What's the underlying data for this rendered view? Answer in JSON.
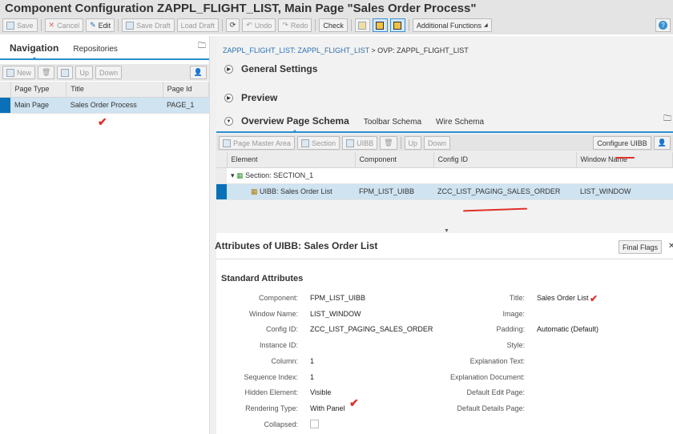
{
  "title": "Component Configuration ZAPPL_FLIGHT_LIST, Main Page \"Sales Order Process\"",
  "toolbar": {
    "save": "Save",
    "cancel": "Cancel",
    "edit": "Edit",
    "save_draft": "Save Draft",
    "load_draft": "Load Draft",
    "undo": "Undo",
    "redo": "Redo",
    "check": "Check",
    "additional": "Additional Functions"
  },
  "left": {
    "tabs": [
      "Navigation",
      "Repositories"
    ],
    "buttons": {
      "new": "New",
      "up": "Up",
      "down": "Down"
    },
    "columns": [
      "Page Type",
      "Title",
      "Page Id"
    ],
    "rows": [
      {
        "type": "Main Page",
        "title": "Sales Order Process",
        "id": "PAGE_1"
      }
    ]
  },
  "right": {
    "breadcrumb_link": "ZAPPL_FLIGHT_LIST: ZAPPL_FLIGHT_LIST",
    "breadcrumb_rest": "> OVP: ZAPPL_FLIGHT_LIST",
    "panels": [
      "General Settings",
      "Preview"
    ],
    "schema_tabs": [
      "Overview Page Schema",
      "Toolbar Schema",
      "Wire Schema"
    ],
    "schema_buttons": {
      "master": "Page Master Area",
      "section": "Section",
      "uibb": "UIBB",
      "up": "Up",
      "down": "Down",
      "configure": "Configure UIBB"
    },
    "columns": [
      "Element",
      "Component",
      "Config ID",
      "Window Name"
    ],
    "rows": [
      {
        "element": "Section: SECTION_1",
        "component": "",
        "config": "",
        "window": ""
      },
      {
        "element": "UIBB: Sales Order List",
        "component": "FPM_LIST_UIBB",
        "config": "ZCC_LIST_PAGING_SALES_ORDER",
        "window": "LIST_WINDOW"
      }
    ]
  },
  "attributes": {
    "title": "Attributes of UIBB: Sales Order List",
    "final_flags": "Final Flags",
    "section": "Standard Attributes",
    "left": [
      [
        "Component:",
        "FPM_LIST_UIBB"
      ],
      [
        "Window Name:",
        "LIST_WINDOW"
      ],
      [
        "Config ID:",
        "ZCC_LIST_PAGING_SALES_ORDER"
      ],
      [
        "Instance ID:",
        ""
      ],
      [
        "Column:",
        "1"
      ],
      [
        "Sequence Index:",
        "1"
      ],
      [
        "Hidden Element:",
        "Visible"
      ],
      [
        "Rendering Type:",
        "With Panel"
      ],
      [
        "Collapsed:",
        ""
      ]
    ],
    "right": [
      [
        "Title:",
        "Sales Order List"
      ],
      [
        "Image:",
        ""
      ],
      [
        "Padding:",
        "Automatic (Default)"
      ],
      [
        "Style:",
        ""
      ],
      [
        "Explanation Text:",
        ""
      ],
      [
        "Explanation Document:",
        ""
      ],
      [
        "Default Edit Page:",
        ""
      ],
      [
        "Default Details Page:",
        ""
      ]
    ]
  }
}
